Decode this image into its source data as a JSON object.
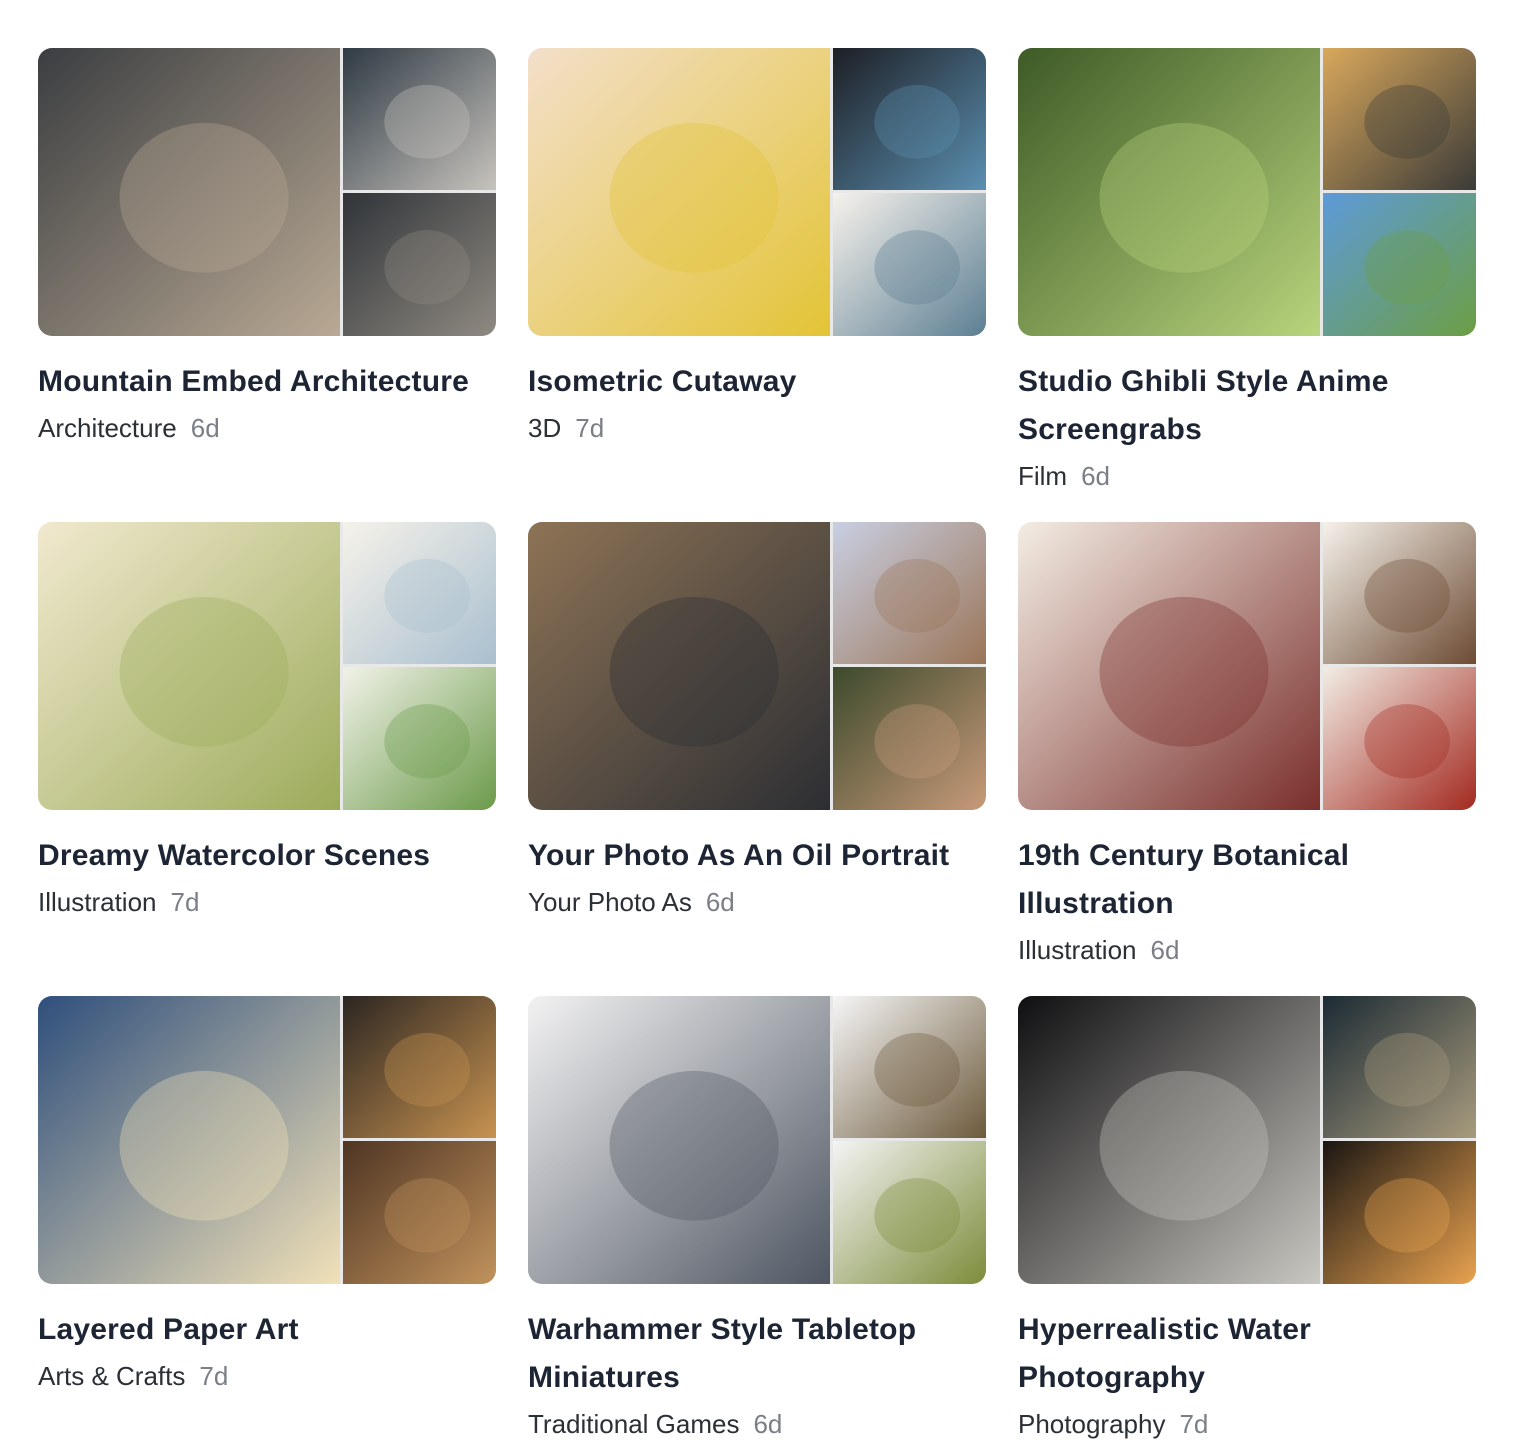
{
  "cards": [
    {
      "title": "Mountain Embed Architecture",
      "category": "Architecture",
      "age": "6d",
      "palette": {
        "main": [
          "#3a3d40",
          "#b9a994"
        ],
        "top": [
          "#2f3a44",
          "#c7c3bd"
        ],
        "bottom": [
          "#303438",
          "#8f8a82"
        ]
      }
    },
    {
      "title": "Isometric Cutaway",
      "category": "3D",
      "age": "7d",
      "palette": {
        "main": [
          "#f3dfca",
          "#e3c436"
        ],
        "top": [
          "#1d1f25",
          "#5b8fb0"
        ],
        "bottom": [
          "#f7f2ec",
          "#5c7f93"
        ]
      }
    },
    {
      "title": "Studio Ghibli Style Anime Screengrabs",
      "category": "Film",
      "age": "6d",
      "palette": {
        "main": [
          "#3e5a26",
          "#b8d47c"
        ],
        "top": [
          "#d9a85c",
          "#3b3b38"
        ],
        "bottom": [
          "#5d9ad9",
          "#6c9e44"
        ]
      }
    },
    {
      "title": "Dreamy Watercolor Scenes",
      "category": "Illustration",
      "age": "7d",
      "palette": {
        "main": [
          "#f1e9cf",
          "#9cab5a"
        ],
        "top": [
          "#f6f2ea",
          "#a9bfcf"
        ],
        "bottom": [
          "#f1f2e8",
          "#6b9a4a"
        ]
      }
    },
    {
      "title": "Your Photo As An Oil Portrait",
      "category": "Your Photo As",
      "age": "6d",
      "palette": {
        "main": [
          "#8d7355",
          "#2c2e33"
        ],
        "top": [
          "#c9cfe2",
          "#9a7558"
        ],
        "bottom": [
          "#3d4a2c",
          "#c79a7a"
        ]
      }
    },
    {
      "title": "19th Century Botanical Illustration",
      "category": "Illustration",
      "age": "6d",
      "palette": {
        "main": [
          "#f3ede3",
          "#7a2f2c"
        ],
        "top": [
          "#f5f1ea",
          "#6d4b33"
        ],
        "bottom": [
          "#f2ede5",
          "#a32a20"
        ]
      }
    },
    {
      "title": "Layered Paper Art",
      "category": "Arts & Crafts",
      "age": "7d",
      "palette": {
        "main": [
          "#2f4f7c",
          "#f1e1b8"
        ],
        "top": [
          "#2c2622",
          "#c79250"
        ],
        "bottom": [
          "#4f3523",
          "#c1925c"
        ]
      }
    },
    {
      "title": "Warhammer Style Tabletop Miniatures",
      "category": "Traditional Games",
      "age": "6d",
      "palette": {
        "main": [
          "#f2f2f2",
          "#4f5662"
        ],
        "top": [
          "#f6f6f6",
          "#6d5a3c"
        ],
        "bottom": [
          "#f4f4f4",
          "#7c8c3a"
        ]
      }
    },
    {
      "title": "Hyperrealistic Water Photography",
      "category": "Photography",
      "age": "7d",
      "palette": {
        "main": [
          "#0f0f11",
          "#c9c7c1"
        ],
        "top": [
          "#1c2b34",
          "#a89b7d"
        ],
        "bottom": [
          "#1a1612",
          "#e9a24f"
        ]
      }
    }
  ]
}
